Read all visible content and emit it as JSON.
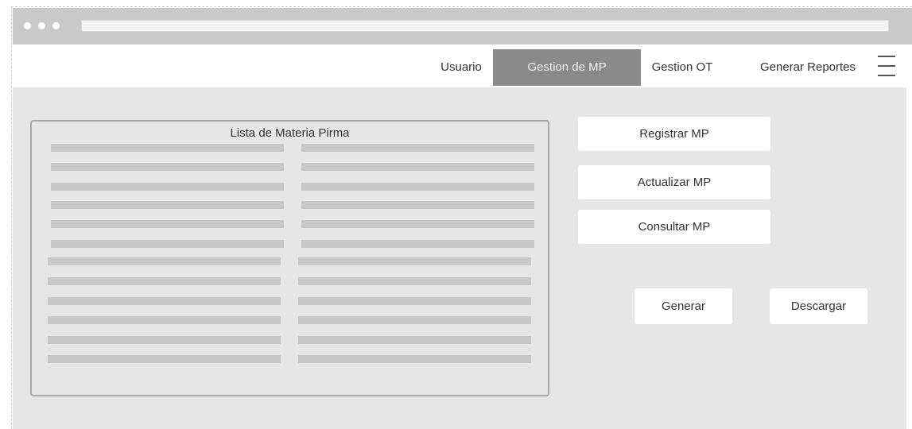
{
  "nav": {
    "items": [
      {
        "label": "Usuario",
        "active": false
      },
      {
        "label": "Gestion de MP",
        "active": true
      },
      {
        "label": "Gestion OT",
        "active": false
      },
      {
        "label": "Generar Reportes",
        "active": false
      }
    ],
    "active_color": "#8a8a8a"
  },
  "list": {
    "title": "Lista de Materia Pirma",
    "row_count": 12,
    "column_count": 2
  },
  "actions": {
    "registrar": "Registrar MP",
    "actualizar": "Actualizar MP",
    "consultar": "Consultar MP",
    "generar": "Generar",
    "descargar": "Descargar"
  },
  "icons": {
    "window_controls": "three-dots-icon",
    "menu": "hamburger-menu-icon"
  }
}
